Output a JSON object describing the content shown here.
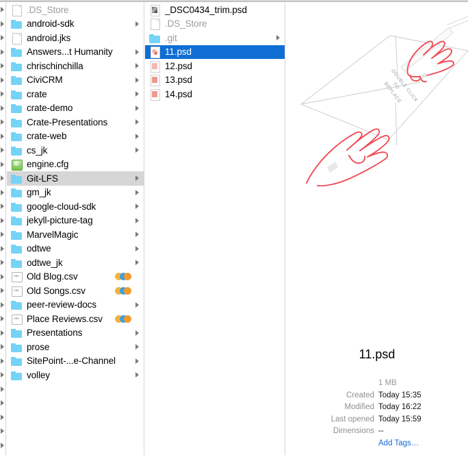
{
  "window": {
    "view": "column-view"
  },
  "stub_column": {
    "arrow_rows": [
      0,
      1,
      2,
      3,
      4,
      5,
      6,
      7,
      8,
      9,
      10,
      11,
      12,
      13,
      14,
      15,
      16,
      17,
      18,
      19,
      20,
      21,
      22,
      23,
      24,
      25,
      26,
      27,
      28,
      29,
      30,
      31
    ]
  },
  "column_one": {
    "items": [
      {
        "name": ".DS_Store",
        "icon": "document-icon",
        "kind": "file",
        "dim": true,
        "arrow": false,
        "tags": []
      },
      {
        "name": "android-sdk",
        "icon": "folder-icon",
        "kind": "folder",
        "dim": false,
        "arrow": true,
        "tags": []
      },
      {
        "name": "android.jks",
        "icon": "document-icon",
        "kind": "file",
        "dim": false,
        "arrow": false,
        "tags": []
      },
      {
        "name": "Answers...t Humanity",
        "icon": "folder-icon",
        "kind": "folder",
        "dim": false,
        "arrow": true,
        "tags": []
      },
      {
        "name": "chrischinchilla",
        "icon": "folder-icon",
        "kind": "folder",
        "dim": false,
        "arrow": true,
        "tags": []
      },
      {
        "name": "CiviCRM",
        "icon": "folder-icon",
        "kind": "folder",
        "dim": false,
        "arrow": true,
        "tags": []
      },
      {
        "name": "crate",
        "icon": "folder-icon",
        "kind": "folder",
        "dim": false,
        "arrow": true,
        "tags": []
      },
      {
        "name": "crate-demo",
        "icon": "folder-icon",
        "kind": "folder",
        "dim": false,
        "arrow": true,
        "tags": []
      },
      {
        "name": "Crate-Presentations",
        "icon": "folder-icon",
        "kind": "folder",
        "dim": false,
        "arrow": true,
        "tags": []
      },
      {
        "name": "crate-web",
        "icon": "folder-icon",
        "kind": "folder",
        "dim": false,
        "arrow": true,
        "tags": []
      },
      {
        "name": "cs_jk",
        "icon": "folder-icon",
        "kind": "folder",
        "dim": false,
        "arrow": true,
        "tags": []
      },
      {
        "name": "engine.cfg",
        "icon": "config-file-icon",
        "kind": "file",
        "dim": false,
        "arrow": false,
        "tags": []
      },
      {
        "name": "Git-LFS",
        "icon": "folder-icon",
        "kind": "folder",
        "dim": false,
        "arrow": true,
        "tags": [],
        "selected_inactive": true
      },
      {
        "name": "gm_jk",
        "icon": "folder-icon",
        "kind": "folder",
        "dim": false,
        "arrow": true,
        "tags": []
      },
      {
        "name": "google-cloud-sdk",
        "icon": "folder-icon",
        "kind": "folder",
        "dim": false,
        "arrow": true,
        "tags": []
      },
      {
        "name": "jekyll-picture-tag",
        "icon": "folder-icon",
        "kind": "folder",
        "dim": false,
        "arrow": true,
        "tags": []
      },
      {
        "name": "MarvelMagic",
        "icon": "folder-icon",
        "kind": "folder",
        "dim": false,
        "arrow": true,
        "tags": []
      },
      {
        "name": "odtwe",
        "icon": "folder-icon",
        "kind": "folder",
        "dim": false,
        "arrow": true,
        "tags": []
      },
      {
        "name": "odtwe_jk",
        "icon": "folder-icon",
        "kind": "folder",
        "dim": false,
        "arrow": true,
        "tags": []
      },
      {
        "name": "Old Blog.csv",
        "icon": "csv-file-icon",
        "kind": "file",
        "dim": false,
        "arrow": false,
        "tags": [
          "orange",
          "blue",
          "orange"
        ]
      },
      {
        "name": "Old Songs.csv",
        "icon": "csv-file-icon",
        "kind": "file",
        "dim": false,
        "arrow": false,
        "tags": [
          "orange",
          "blue",
          "orange"
        ]
      },
      {
        "name": "peer-review-docs",
        "icon": "folder-icon",
        "kind": "folder",
        "dim": false,
        "arrow": true,
        "tags": []
      },
      {
        "name": "Place Reviews.csv",
        "icon": "csv-file-icon",
        "kind": "file",
        "dim": false,
        "arrow": false,
        "tags": [
          "orange",
          "blue",
          "orange"
        ]
      },
      {
        "name": "Presentations",
        "icon": "folder-icon",
        "kind": "folder",
        "dim": false,
        "arrow": true,
        "tags": []
      },
      {
        "name": "prose",
        "icon": "folder-icon",
        "kind": "folder",
        "dim": false,
        "arrow": true,
        "tags": []
      },
      {
        "name": "SitePoint-...e-Channel",
        "icon": "folder-icon",
        "kind": "folder",
        "dim": false,
        "arrow": true,
        "tags": []
      },
      {
        "name": "volley",
        "icon": "folder-icon",
        "kind": "folder",
        "dim": false,
        "arrow": true,
        "tags": []
      }
    ]
  },
  "column_two": {
    "items": [
      {
        "name": "_DSC0434_trim.psd",
        "icon": "psd-thumbnail-dark-icon",
        "kind": "file",
        "dim": false,
        "arrow": false,
        "selected": false
      },
      {
        "name": ".DS_Store",
        "icon": "document-icon",
        "kind": "file",
        "dim": true,
        "arrow": false,
        "selected": false
      },
      {
        "name": ".git",
        "icon": "folder-icon",
        "kind": "folder",
        "dim": true,
        "arrow": true,
        "selected": false
      },
      {
        "name": "11.psd",
        "icon": "psd-thumbnail-icon",
        "kind": "file",
        "dim": false,
        "arrow": false,
        "selected": true
      },
      {
        "name": "12.psd",
        "icon": "psd-thumbnail-b-icon",
        "kind": "file",
        "dim": false,
        "arrow": false,
        "selected": false
      },
      {
        "name": "13.psd",
        "icon": "psd-thumbnail-c-icon",
        "kind": "file",
        "dim": false,
        "arrow": false,
        "selected": false
      },
      {
        "name": "14.psd",
        "icon": "psd-thumbnail-c-icon",
        "kind": "file",
        "dim": false,
        "arrow": false,
        "selected": false
      }
    ]
  },
  "preview": {
    "artwork_caption": "DOUBLE CLICK TO REPLACE",
    "filename": "11.psd",
    "size": "1 MB",
    "labels": {
      "created": "Created",
      "modified": "Modified",
      "last_opened": "Last opened",
      "dimensions": "Dimensions"
    },
    "values": {
      "created": "Today 15:35",
      "modified": "Today 16:22",
      "last_opened": "Today 15:59",
      "dimensions": "--"
    },
    "add_tags": "Add Tags…"
  },
  "colors": {
    "selection_blue": "#0f6ed4",
    "inactive_selection": "#d6d6d6",
    "folder_blue": "#74d3f7",
    "link_blue": "#1569d6",
    "tag_orange": "#f6b33c",
    "tag_blue": "#3aa0e6",
    "artwork_red": "#ef4d57"
  }
}
